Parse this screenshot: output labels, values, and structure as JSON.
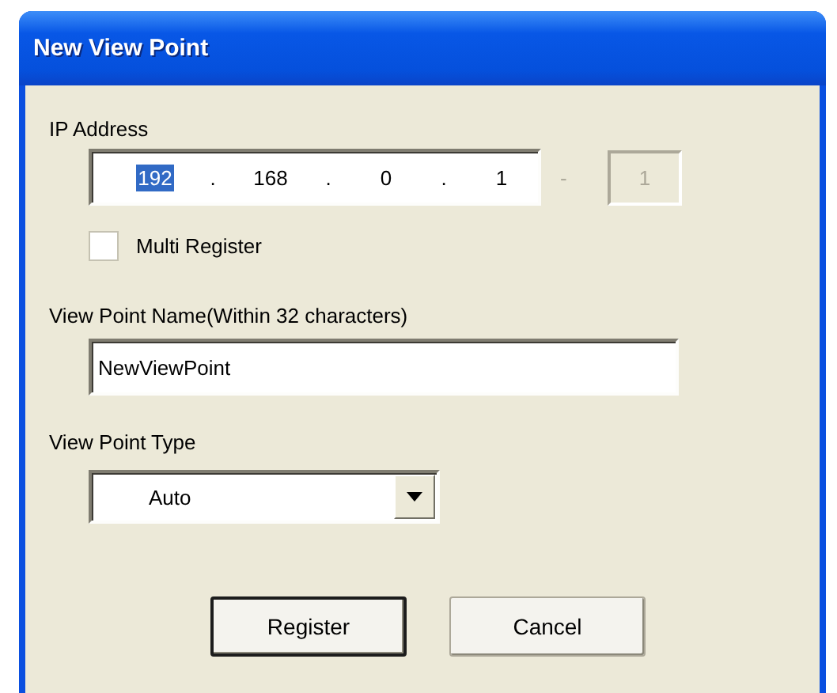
{
  "window": {
    "title": "New View Point"
  },
  "ip_address": {
    "label": "IP Address",
    "octets": [
      {
        "value": "192",
        "selected": true
      },
      {
        "value": "168",
        "selected": false
      },
      {
        "value": "0",
        "selected": false
      },
      {
        "value": "1",
        "selected": false
      }
    ],
    "separators": [
      ".",
      ".",
      "."
    ],
    "range_separator": "-",
    "range_end": {
      "value": "1",
      "disabled": true
    }
  },
  "multi_register": {
    "label": "Multi Register",
    "checked": false
  },
  "name_field": {
    "label": "View Point Name(Within 32 characters)",
    "value": "NewViewPoint"
  },
  "type_field": {
    "label": "View Point Type",
    "value": "Auto"
  },
  "buttons": [
    {
      "label": "Register",
      "default": true
    },
    {
      "label": "Cancel",
      "default": false
    }
  ]
}
